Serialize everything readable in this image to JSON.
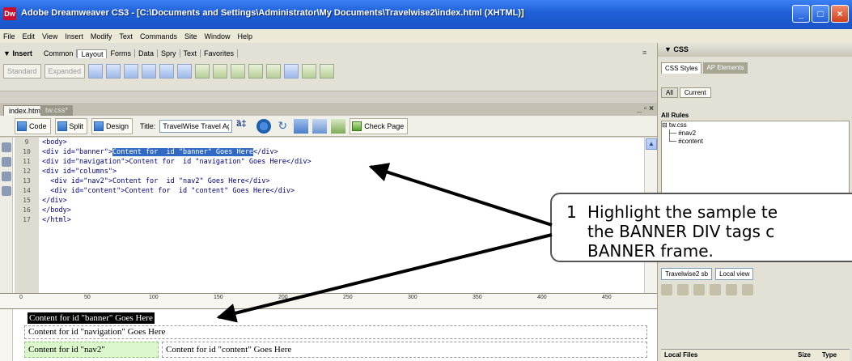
{
  "window": {
    "title": "Adobe Dreamweaver CS3 - [C:\\Documents and Settings\\Administrator\\My Documents\\Travelwise2\\index.html (XHTML)]",
    "icon_label": "Dw",
    "minimize": "_",
    "maximize": "□",
    "close": "×"
  },
  "menu": [
    "File",
    "Edit",
    "View",
    "Insert",
    "Modify",
    "Text",
    "Commands",
    "Site",
    "Window",
    "Help"
  ],
  "insert_panel": {
    "title": "▼ Insert",
    "tabs": [
      "Common",
      "Layout",
      "Forms",
      "Data",
      "Spry",
      "Text",
      "Favorites"
    ],
    "active_tab": "Layout",
    "mode_buttons": [
      "Standard",
      "Expanded"
    ]
  },
  "document": {
    "tabs": [
      "index.html",
      "tw.css*"
    ],
    "controls": "_ ▫ ×",
    "toolbar": {
      "code": "Code",
      "split": "Split",
      "design": "Design",
      "title_label": "Title:",
      "title_value": "TravelWise Travel Agency",
      "check_page": "Check Page"
    },
    "line_numbers": [
      "9",
      "10",
      "11",
      "12",
      "13",
      "14",
      "15",
      "16",
      "17"
    ],
    "code": [
      {
        "pre": "<body>",
        "hl": "",
        "post": ""
      },
      {
        "pre": "<div id=\"banner\">",
        "hl": "Content for  id \"banner\" Goes Here",
        "post": "</div>"
      },
      {
        "pre": "<div id=\"navigation\">Content for  id \"navigation\" Goes Here</div>",
        "hl": "",
        "post": ""
      },
      {
        "pre": "<div id=\"columns\">",
        "hl": "",
        "post": ""
      },
      {
        "pre": "  <div id=\"nav2\">Content for  id \"nav2\" Goes Here</div>",
        "hl": "",
        "post": ""
      },
      {
        "pre": "  <div id=\"content\">Content for  id \"content\" Goes Here</div>",
        "hl": "",
        "post": ""
      },
      {
        "pre": "</div>",
        "hl": "",
        "post": ""
      },
      {
        "pre": "</body>",
        "hl": "",
        "post": ""
      },
      {
        "pre": "</html>",
        "hl": "",
        "post": ""
      }
    ],
    "ruler_marks": [
      "0",
      "50",
      "100",
      "150",
      "200",
      "250",
      "300",
      "350",
      "400",
      "450"
    ],
    "design": {
      "banner": "Content for id \"banner\" Goes Here",
      "navigation": "Content for id \"navigation\" Goes Here",
      "nav2": "Content for id \"nav2\"",
      "content": "Content for id \"content\" Goes Here"
    }
  },
  "css_panel": {
    "title": "▼ CSS",
    "tabs": [
      "CSS Styles",
      "AP Elements"
    ],
    "toggle": [
      "All",
      "Current"
    ],
    "all_rules_label": "All Rules",
    "rules": [
      "⊟ tw.css",
      "   ├─ #nav2",
      "   └─ #content"
    ]
  },
  "files_panel": {
    "site": "Travelwise2 sb",
    "view": "Local view",
    "columns": [
      "Local Files",
      "Size",
      "Type"
    ]
  },
  "callout": {
    "number": "1",
    "text": "Highlight the sample te\nthe BANNER DIV tags c\nBANNER frame."
  },
  "colors": {
    "titlebar": "#1f5fd6",
    "selection": "#316ac5",
    "arrow": "#000000",
    "nav2_bg": "#ddf7cc"
  }
}
